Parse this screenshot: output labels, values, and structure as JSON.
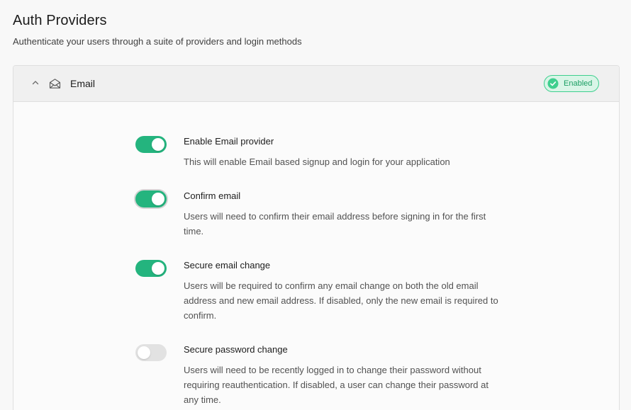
{
  "page": {
    "title": "Auth Providers",
    "subtitle": "Authenticate your users through a suite of providers and login methods"
  },
  "provider": {
    "name": "Email",
    "icon": "mail-open-icon",
    "expanded": true,
    "status_label": "Enabled",
    "status_color": "#3ecf8e"
  },
  "settings": [
    {
      "label": "Enable Email provider",
      "description": "This will enable Email based signup and login for your application",
      "enabled": true
    },
    {
      "label": "Confirm email",
      "description": "Users will need to confirm their email address before signing in for the first time.",
      "enabled": true
    },
    {
      "label": "Secure email change",
      "description": "Users will be required to confirm any email change on both the old email address and new email address. If disabled, only the new email is required to confirm.",
      "enabled": true
    },
    {
      "label": "Secure password change",
      "description": "Users will need to be recently logged in to change their password without requiring reauthentication. If disabled, a user can change their password at any time.",
      "enabled": false
    }
  ],
  "colors": {
    "accent": "#24b47e",
    "toggle_off": "#e2e2e2"
  }
}
